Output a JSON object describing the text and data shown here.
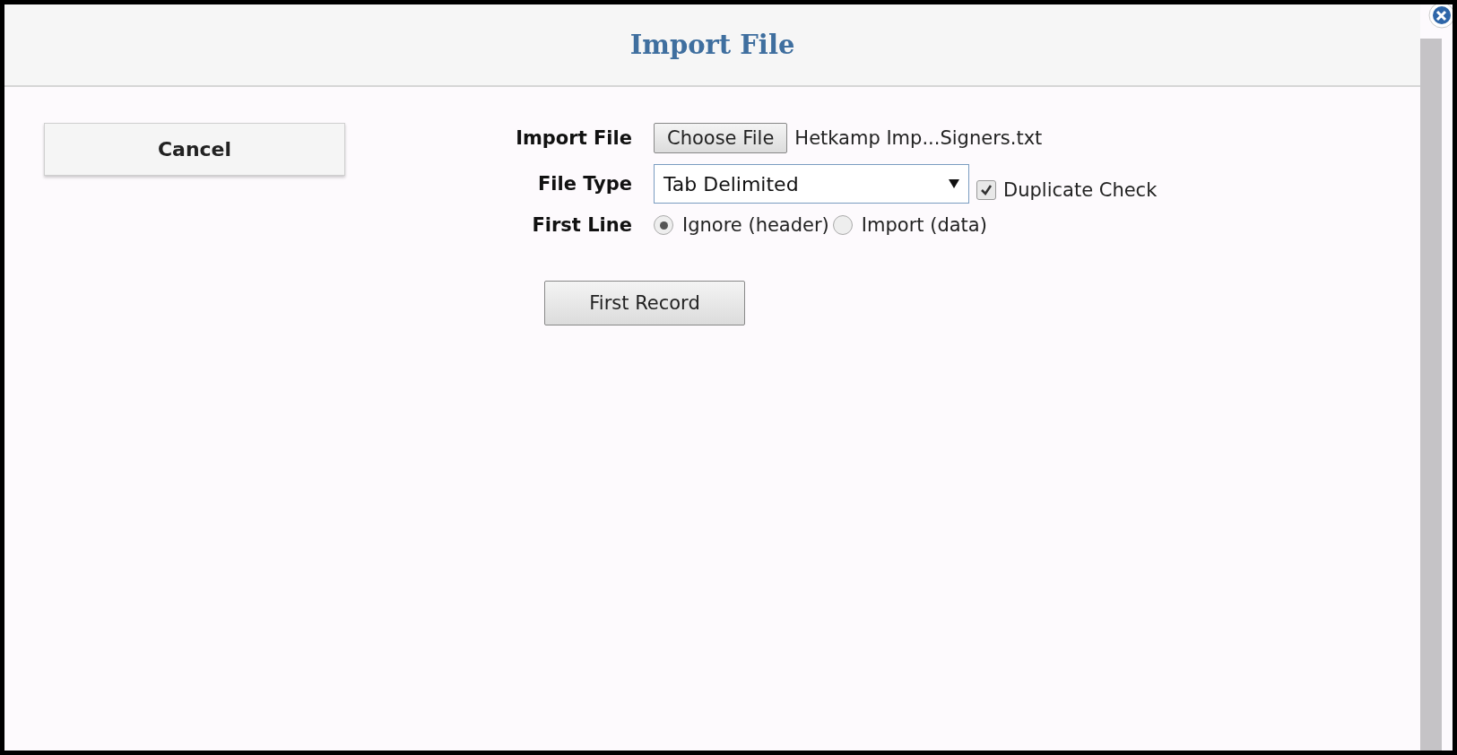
{
  "dialog": {
    "title": "Import File"
  },
  "cancel_button": "Cancel",
  "import_file": {
    "label": "Import File",
    "button": "Choose File",
    "file_name": "Hetkamp Imp...Signers.txt"
  },
  "file_type": {
    "label": "File Type",
    "value": "Tab Delimited",
    "duplicate_check": {
      "label": "Duplicate Check",
      "checked": true
    }
  },
  "first_line": {
    "label": "First Line",
    "options": [
      {
        "label": "Ignore (header)",
        "selected": true
      },
      {
        "label": "Import (data)",
        "selected": false
      }
    ]
  },
  "first_record_button": "First Record"
}
